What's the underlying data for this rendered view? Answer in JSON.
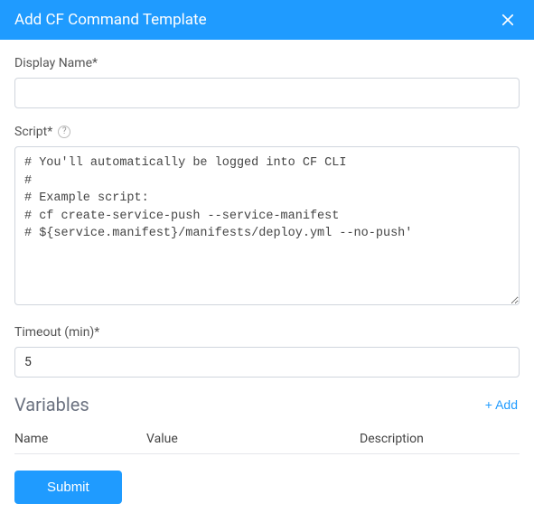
{
  "header": {
    "title": "Add CF Command Template"
  },
  "fields": {
    "displayName": {
      "label": "Display Name*",
      "value": ""
    },
    "script": {
      "label": "Script*",
      "value": "# You'll automatically be logged into CF CLI\n#\n# Example script:\n# cf create-service-push --service-manifest\n# ${service.manifest}/manifests/deploy.yml --no-push'"
    },
    "timeout": {
      "label": "Timeout (min)*",
      "value": "5"
    }
  },
  "variables": {
    "title": "Variables",
    "add_label": "+ Add",
    "columns": {
      "name": "Name",
      "value": "Value",
      "description": "Description"
    },
    "rows": []
  },
  "actions": {
    "submit_label": "Submit"
  }
}
